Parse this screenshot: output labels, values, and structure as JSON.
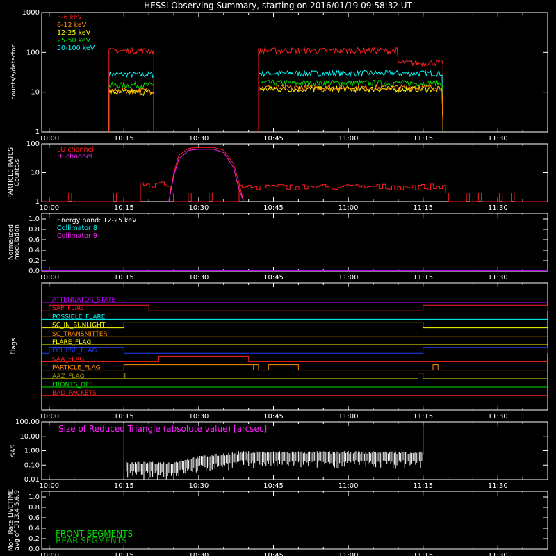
{
  "title": "HESSI Observing Summary, starting on 2016/01/19 09:58:32 UT",
  "x_ticks": [
    "10:00",
    "10:15",
    "10:30",
    "10:45",
    "11:00",
    "11:15",
    "11:30"
  ],
  "colors": {
    "red": "#ff2020",
    "orange": "#ff9000",
    "yellow": "#ffff00",
    "green": "#00e000",
    "cyan": "#00ffff",
    "magenta": "#ff20ff",
    "purple": "#c000ff",
    "blue": "#2040ff",
    "olive": "#a0a000",
    "dkgreen": "#00b000"
  },
  "chart_data": [
    {
      "type": "line",
      "name": "count rates",
      "ylabel": "counts/s/detector",
      "yscale": "log",
      "ylim": [
        1,
        1000
      ],
      "y_ticks": [
        "1",
        "10",
        "100",
        "1000"
      ],
      "legend_placement": "top-left",
      "series": [
        {
          "name": "3-6 keV",
          "color": "red",
          "segments": [
            {
              "x": [
                "10:12",
                "10:21"
              ],
              "y": 110
            },
            {
              "x": [
                "10:42",
                "11:10"
              ],
              "y": 112
            },
            {
              "x": [
                "11:10",
                "11:19"
              ],
              "y": 55
            }
          ]
        },
        {
          "name": "6-12 keV",
          "color": "orange",
          "segments": [
            {
              "x": [
                "10:12",
                "10:21"
              ],
              "y": 11
            },
            {
              "x": [
                "10:42",
                "11:19"
              ],
              "y": 13
            }
          ]
        },
        {
          "name": "12-25 keV",
          "color": "yellow",
          "segments": [
            {
              "x": [
                "10:12",
                "10:21"
              ],
              "y": 10
            },
            {
              "x": [
                "10:42",
                "11:19"
              ],
              "y": 12
            }
          ]
        },
        {
          "name": "25-50 keV",
          "color": "green",
          "segments": [
            {
              "x": [
                "10:12",
                "10:21"
              ],
              "y": 15
            },
            {
              "x": [
                "10:42",
                "11:19"
              ],
              "y": 17
            }
          ]
        },
        {
          "name": "50-100 keV",
          "color": "cyan",
          "segments": [
            {
              "x": [
                "10:12",
                "10:21"
              ],
              "y": 28
            },
            {
              "x": [
                "10:42",
                "11:19"
              ],
              "y": 30
            }
          ]
        }
      ]
    },
    {
      "type": "line",
      "name": "particle rates",
      "ylabel": [
        "PARTICLE RATES",
        "Counts/s"
      ],
      "yscale": "log",
      "ylim": [
        1,
        100
      ],
      "y_ticks": [
        "1",
        "10",
        "100"
      ],
      "series": [
        {
          "name": "LO channel",
          "color": "red",
          "points": [
            [
              "10:24",
              1
            ],
            [
              "10:25",
              10
            ],
            [
              "10:26",
              40
            ],
            [
              "10:28",
              70
            ],
            [
              "10:30",
              75
            ],
            [
              "10:33",
              75
            ],
            [
              "10:35",
              60
            ],
            [
              "10:37",
              20
            ],
            [
              "10:38",
              5
            ],
            [
              "10:39",
              1
            ]
          ]
        },
        {
          "name": "HI channel",
          "color": "magenta",
          "points": [
            [
              "10:24",
              1
            ],
            [
              "10:25",
              8
            ],
            [
              "10:26",
              30
            ],
            [
              "10:28",
              60
            ],
            [
              "10:30",
              65
            ],
            [
              "10:33",
              65
            ],
            [
              "10:35",
              50
            ],
            [
              "10:37",
              15
            ],
            [
              "10:38",
              3
            ],
            [
              "10:39",
              1
            ]
          ]
        }
      ]
    },
    {
      "type": "line",
      "name": "modulation",
      "ylabel": [
        "Normalized",
        "modulation"
      ],
      "ylim": [
        0,
        1
      ],
      "y_ticks": [
        "0.0",
        "0.2",
        "0.4",
        "0.6",
        "0.8",
        "1.0"
      ],
      "annotation": "Energy band: 12-25 keV",
      "series": [
        {
          "name": "Collimator 8",
          "color": "cyan"
        },
        {
          "name": "Collimator 9",
          "color": "magenta"
        }
      ]
    },
    {
      "type": "line",
      "name": "flags",
      "ylabel": "Flags",
      "series": [
        {
          "name": "ATTENUATOR_STATE",
          "color": "purple",
          "on": []
        },
        {
          "name": "SAP_FLAG",
          "color": "red",
          "on": [
            [
              "10:00",
              "10:20"
            ],
            [
              "11:15",
              "11:40"
            ]
          ]
        },
        {
          "name": "POSSIBLE_FLARE",
          "color": "cyan",
          "on": []
        },
        {
          "name": "SC_IN_SUNLIGHT",
          "color": "yellow",
          "on": [
            [
              "10:15",
              "11:15"
            ]
          ]
        },
        {
          "name": "SC_TRANSMITTER",
          "color": "orange",
          "on": []
        },
        {
          "name": "FLARE_FLAG",
          "color": "yellow",
          "on": []
        },
        {
          "name": "ECLIPSE_FLAG",
          "color": "blue",
          "on": [
            [
              "10:00",
              "10:15"
            ],
            [
              "11:15",
              "11:40"
            ]
          ]
        },
        {
          "name": "SAA_FLAG",
          "color": "red",
          "on": [
            [
              "10:22",
              "10:40"
            ]
          ]
        },
        {
          "name": "PARTICLE_FLAG",
          "color": "orange",
          "on": [
            [
              "10:15",
              "10:41"
            ],
            [
              "10:41",
              "10:42"
            ],
            [
              "10:44",
              "10:50"
            ],
            [
              "11:17",
              "11:18"
            ]
          ]
        },
        {
          "name": "AAZ_FLAG",
          "color": "olive",
          "on": [
            [
              "10:15",
              "10:15"
            ],
            [
              "11:14",
              "11:15"
            ]
          ]
        },
        {
          "name": "FRONTS_OFF",
          "color": "green",
          "on": []
        },
        {
          "name": "BAD_PACKETS",
          "color": "red",
          "on": []
        }
      ]
    },
    {
      "type": "line",
      "name": "sas",
      "ylabel": "SAS",
      "yscale": "log",
      "ylim": [
        0.01,
        100
      ],
      "y_ticks": [
        "0.01",
        "0.10",
        "1.00",
        "10.00",
        "100.00"
      ],
      "annotation": "Size of Reduced Triangle (absolute value) [arcsec]",
      "series": [
        {
          "name": "triangle",
          "color": "white",
          "points": [
            [
              "10:15",
              100
            ],
            [
              "10:16",
              0.2
            ],
            [
              "10:20",
              0.1
            ],
            [
              "10:25",
              0.15
            ],
            [
              "10:30",
              0.3
            ],
            [
              "10:35",
              0.5
            ],
            [
              "10:45",
              0.6
            ],
            [
              "11:00",
              0.6
            ],
            [
              "11:14",
              0.6
            ],
            [
              "11:15",
              100
            ]
          ]
        }
      ]
    },
    {
      "type": "line",
      "name": "livetime",
      "ylabel": [
        "Mon. Rate LIVETIME",
        "avg of D1,3,4,5,6,9"
      ],
      "ylim": [
        0,
        1
      ],
      "y_ticks": [
        "0.0",
        "0.2",
        "0.4",
        "0.6",
        "0.8",
        "1.0"
      ],
      "series": [
        {
          "name": "FRONT SEGMENTS",
          "color": "green"
        },
        {
          "name": "REAR SEGMENTS",
          "color": "dkgreen"
        }
      ]
    }
  ]
}
